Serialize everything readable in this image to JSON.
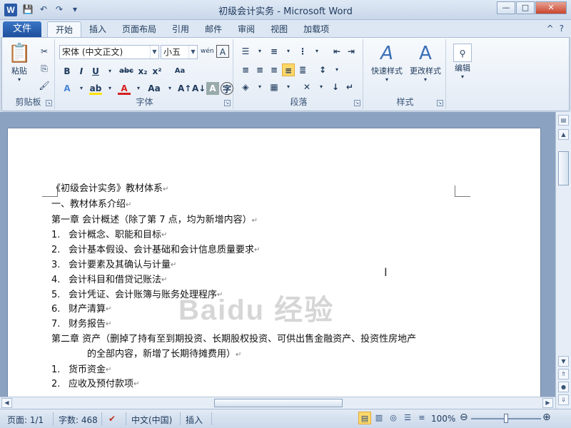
{
  "window": {
    "title": "初级会计实务 - Microsoft Word",
    "app_icon": "W",
    "controls": {
      "minimize": "—",
      "maximize": "□",
      "close": "✕"
    }
  },
  "qat": {
    "save_icon": "💾",
    "undo_icon": "↶",
    "redo_icon": "↷",
    "customize_icon": "▾"
  },
  "tabs": {
    "file": "文件",
    "items": [
      "开始",
      "插入",
      "页面布局",
      "引用",
      "邮件",
      "审阅",
      "视图",
      "加载项"
    ],
    "active": "开始",
    "help_icon": "?",
    "minimize_ribbon_icon": "^"
  },
  "ribbon": {
    "clipboard": {
      "label": "剪贴板",
      "paste": "粘贴"
    },
    "font": {
      "label": "字体",
      "font_name": "宋体 (中文正文)",
      "font_size": "小五",
      "phonetic": "wén"
    },
    "paragraph": {
      "label": "段落"
    },
    "styles": {
      "label": "样式",
      "quick_styles": "快速样式",
      "change_styles": "更改样式"
    },
    "editing": {
      "label": "编辑",
      "edit": "编辑"
    }
  },
  "document": {
    "title_line": "《初级会计实务》教材体系",
    "section1": "一、教材体系介绍",
    "chapter1": "第一章 会计概述（除了第 7 点，均为新增内容）",
    "chapter1_items": [
      {
        "num": "1.",
        "text": "会计概念、职能和目标"
      },
      {
        "num": "2.",
        "text": "会计基本假设、会计基础和会计信息质量要求"
      },
      {
        "num": "3.",
        "text": "会计要素及其确认与计量"
      },
      {
        "num": "4.",
        "text": "会计科目和借贷记账法"
      },
      {
        "num": "5.",
        "text": "会计凭证、会计账簿与账务处理程序"
      },
      {
        "num": "6.",
        "text": "财产清算"
      },
      {
        "num": "7.",
        "text": "财务报告"
      }
    ],
    "chapter2_line1": "第二章 资产（删掉了持有至到期投资、长期股权投资、可供出售金融资产、投资性房地产",
    "chapter2_line2": "的全部内容，新增了长期待摊费用）",
    "chapter2_items": [
      {
        "num": "1.",
        "text": "货币资金"
      },
      {
        "num": "2.",
        "text": "应收及预付款项"
      }
    ],
    "watermark": "Baidu 经验"
  },
  "statusbar": {
    "page": "页面: 1/1",
    "words": "字数: 468",
    "language": "中文(中国)",
    "mode": "插入",
    "zoom": "100%",
    "zoom_level": 1.0
  }
}
